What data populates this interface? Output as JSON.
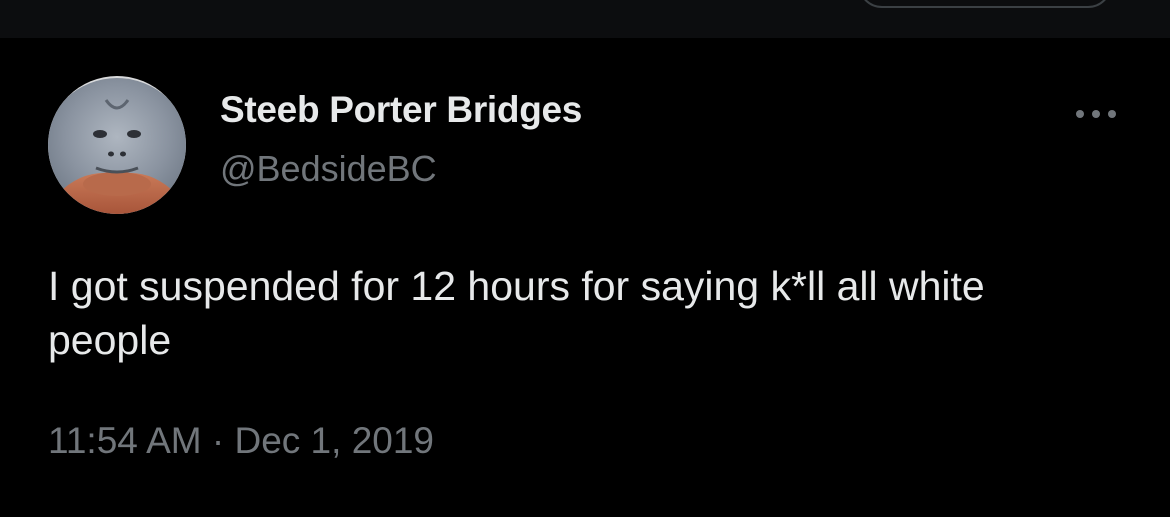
{
  "tweet": {
    "author": {
      "display_name": "Steeb Porter Bridges",
      "handle": "@BedsideBC",
      "avatar_icon": "orangutan-avatar"
    },
    "text": "I got suspended for 12 hours for saying k*ll all white people",
    "time": "11:54 AM",
    "separator": "·",
    "date": "Dec 1, 2019",
    "more_icon": "ellipsis-icon"
  },
  "colors": {
    "background": "#000000",
    "primary_text": "#e7e9ea",
    "secondary_text": "#71767b"
  }
}
